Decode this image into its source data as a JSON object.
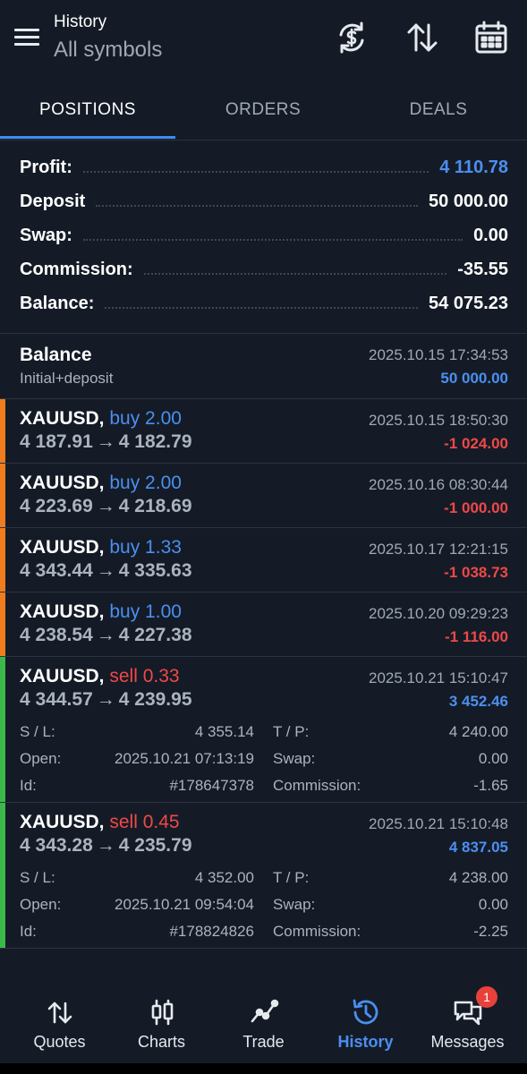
{
  "header": {
    "title": "History",
    "subtitle": "All symbols",
    "icons": [
      "menu-icon",
      "currency-refresh-icon",
      "sort-icon",
      "calendar-icon"
    ]
  },
  "tabs": [
    {
      "label": "POSITIONS",
      "active": true
    },
    {
      "label": "ORDERS",
      "active": false
    },
    {
      "label": "DEALS",
      "active": false
    }
  ],
  "summary": {
    "profit_label": "Profit:",
    "profit_value": "4 110.78",
    "deposit_label": "Deposit",
    "deposit_value": "50 000.00",
    "swap_label": "Swap:",
    "swap_value": "0.00",
    "commission_label": "Commission:",
    "commission_value": "-35.55",
    "balance_label": "Balance:",
    "balance_value": "54 075.23"
  },
  "balance_entry": {
    "title": "Balance",
    "subtitle": "Initial+deposit",
    "datetime": "2025.10.15 17:34:53",
    "amount": "50 000.00"
  },
  "positions": [
    {
      "symbol": "XAUUSD,",
      "type": "buy 2.00",
      "open_price": "4 187.91",
      "arrow": "→",
      "close_price": "4 182.79",
      "datetime": "2025.10.15 18:50:30",
      "profit": "-1 024.00"
    },
    {
      "symbol": "XAUUSD,",
      "type": "buy 2.00",
      "open_price": "4 223.69",
      "arrow": "→",
      "close_price": "4 218.69",
      "datetime": "2025.10.16 08:30:44",
      "profit": "-1 000.00"
    },
    {
      "symbol": "XAUUSD,",
      "type": "buy 1.33",
      "open_price": "4 343.44",
      "arrow": "→",
      "close_price": "4 335.63",
      "datetime": "2025.10.17 12:21:15",
      "profit": "-1 038.73"
    },
    {
      "symbol": "XAUUSD,",
      "type": "buy 1.00",
      "open_price": "4 238.54",
      "arrow": "→",
      "close_price": "4 227.38",
      "datetime": "2025.10.20 09:29:23",
      "profit": "-1 116.00"
    },
    {
      "symbol": "XAUUSD,",
      "type": "sell 0.33",
      "open_price": "4 344.57",
      "arrow": "→",
      "close_price": "4 239.95",
      "datetime": "2025.10.21 15:10:47",
      "profit": "3 452.46",
      "details": {
        "sl_label": "S / L:",
        "sl": "4 355.14",
        "tp_label": "T / P:",
        "tp": "4 240.00",
        "open_label": "Open:",
        "open": "2025.10.21 07:13:19",
        "swap_label": "Swap:",
        "swap": "0.00",
        "id_label": "Id:",
        "id": "#178647378",
        "commission_label": "Commission:",
        "commission": "-1.65"
      }
    },
    {
      "symbol": "XAUUSD,",
      "type": "sell 0.45",
      "open_price": "4 343.28",
      "arrow": "→",
      "close_price": "4 235.79",
      "datetime": "2025.10.21 15:10:48",
      "profit": "4 837.05",
      "details": {
        "sl_label": "S / L:",
        "sl": "4 352.00",
        "tp_label": "T / P:",
        "tp": "4 238.00",
        "open_label": "Open:",
        "open": "2025.10.21 09:54:04",
        "swap_label": "Swap:",
        "swap": "0.00",
        "id_label": "Id:",
        "id": "#178824826",
        "commission_label": "Commission:",
        "commission": "-2.25"
      }
    }
  ],
  "bottom_nav": [
    {
      "label": "Quotes",
      "icon": "quotes-arrows-icon"
    },
    {
      "label": "Charts",
      "icon": "candlestick-icon"
    },
    {
      "label": "Trade",
      "icon": "trade-line-icon"
    },
    {
      "label": "History",
      "icon": "history-clock-icon",
      "active": true
    },
    {
      "label": "Messages",
      "icon": "messages-icon",
      "badge": "1"
    }
  ],
  "colors": {
    "background": "#141b26",
    "accent": "#3d8bf2",
    "positive": "#4b8ff0",
    "negative": "#f04848",
    "buy_bar": "#f07c1e",
    "sell_bar": "#3cb84a"
  }
}
